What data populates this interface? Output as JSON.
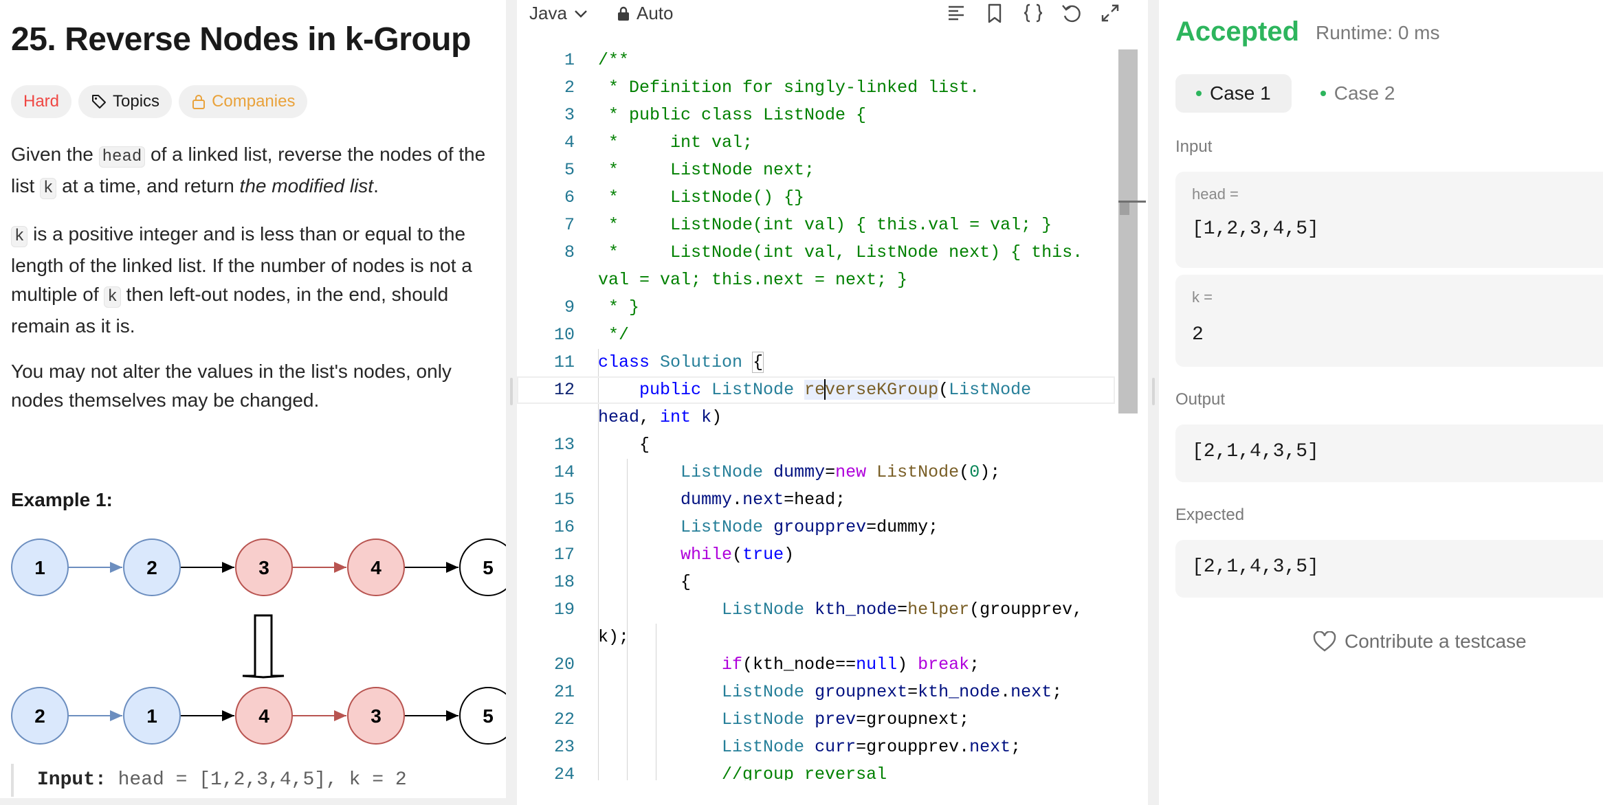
{
  "problem": {
    "title": "25. Reverse Nodes in k-Group",
    "tags": {
      "difficulty": "Hard",
      "topics": "Topics",
      "companies": "Companies"
    },
    "p1": {
      "a": "Given the ",
      "head": "head",
      "b": " of a linked list, reverse the nodes of the list ",
      "k": "k",
      "c": " at a time, and return ",
      "em": "the modified list",
      "d": "."
    },
    "p2": {
      "k1": "k",
      "a": " is a positive integer and is less than or equal to the length of the linked list. If the number of nodes is not a multiple of ",
      "k2": "k",
      "b": " then left-out nodes, in the end, should remain as it is."
    },
    "p3": "You may not alter the values in the list's nodes, only nodes themselves may be changed.",
    "example_title": "Example 1:",
    "diagram": {
      "top": [
        "1",
        "2",
        "3",
        "4",
        "5"
      ],
      "bottom": [
        "2",
        "1",
        "4",
        "3",
        "5"
      ],
      "colors": {
        "blue_fill": "#dae8fc",
        "blue_stroke": "#6c8ebf",
        "red_fill": "#f8cecc",
        "red_stroke": "#b85450"
      }
    },
    "example_input_label": "Input:",
    "example_input_value": " head = [1,2,3,4,5], k = 2"
  },
  "editor": {
    "language": "Java",
    "mode": "Auto",
    "toolbar_icons": [
      "format-icon",
      "bookmark-icon",
      "braces-icon",
      "reset-icon",
      "expand-icon"
    ],
    "line_numbers": [
      "1",
      "2",
      "3",
      "4",
      "5",
      "6",
      "7",
      "8",
      "",
      "9",
      "10",
      "11",
      "12",
      "",
      "13",
      "14",
      "15",
      "16",
      "17",
      "18",
      "19",
      "",
      "20",
      "21",
      "22",
      "23",
      "24"
    ]
  },
  "result": {
    "status": "Accepted",
    "runtime": "Runtime: 0 ms",
    "cases": [
      "Case 1",
      "Case 2"
    ],
    "input_label": "Input",
    "head_label": "head =",
    "head_value": "[1,2,3,4,5]",
    "k_label": "k =",
    "k_value": "2",
    "output_label": "Output",
    "output_value": "[2,1,4,3,5]",
    "expected_label": "Expected",
    "expected_value": "[2,1,4,3,5]",
    "contribute": "Contribute a testcase",
    "accent": "#2db55d"
  }
}
